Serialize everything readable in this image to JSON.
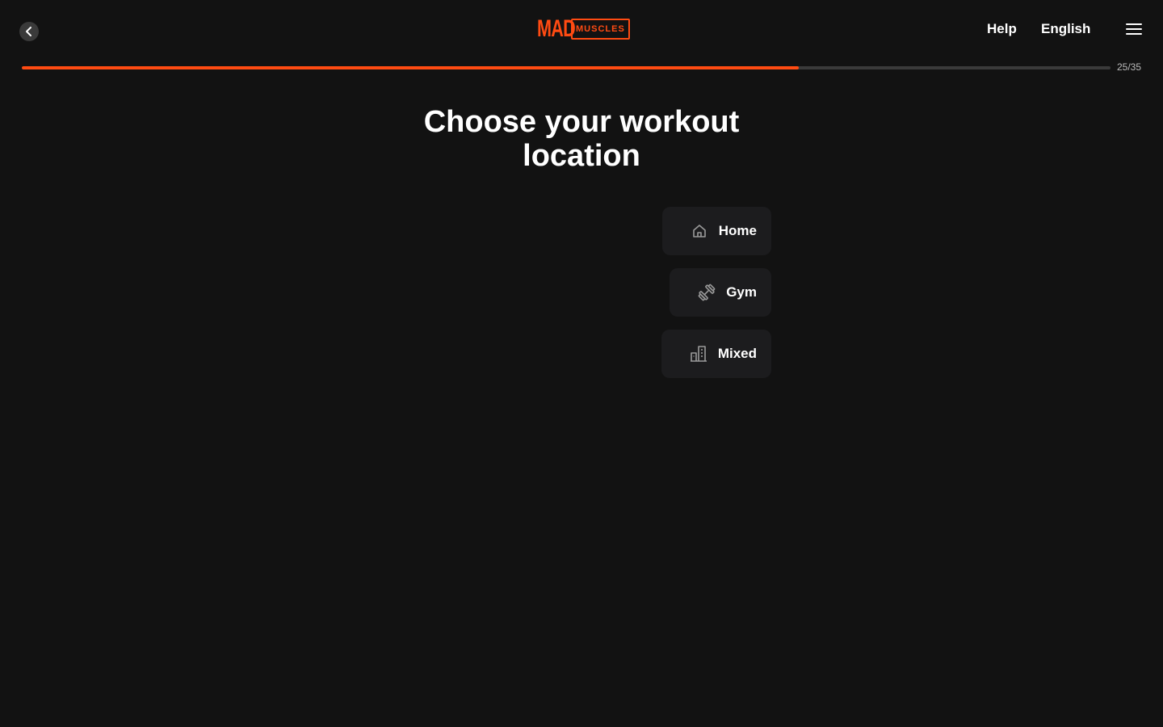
{
  "header": {
    "logo": {
      "mad": "MAD",
      "muscles": "MUSCLES"
    },
    "nav": {
      "help": "Help",
      "language": "English"
    },
    "icons": {
      "back": "chevron-left-icon",
      "menu": "hamburger-menu-icon"
    }
  },
  "progress": {
    "label": "25/35",
    "current": 25,
    "total": 35,
    "fraction": 0.714
  },
  "main": {
    "title": "Choose your workout location",
    "options": [
      {
        "label": "Home",
        "icon": "home-icon"
      },
      {
        "label": "Gym",
        "icon": "dumbbell-icon"
      },
      {
        "label": "Mixed",
        "icon": "buildings-icon"
      }
    ]
  },
  "colors": {
    "accent": "#ff4b12",
    "background": "#121212",
    "card": "#1c1c1e",
    "track": "#3a3a3a"
  }
}
